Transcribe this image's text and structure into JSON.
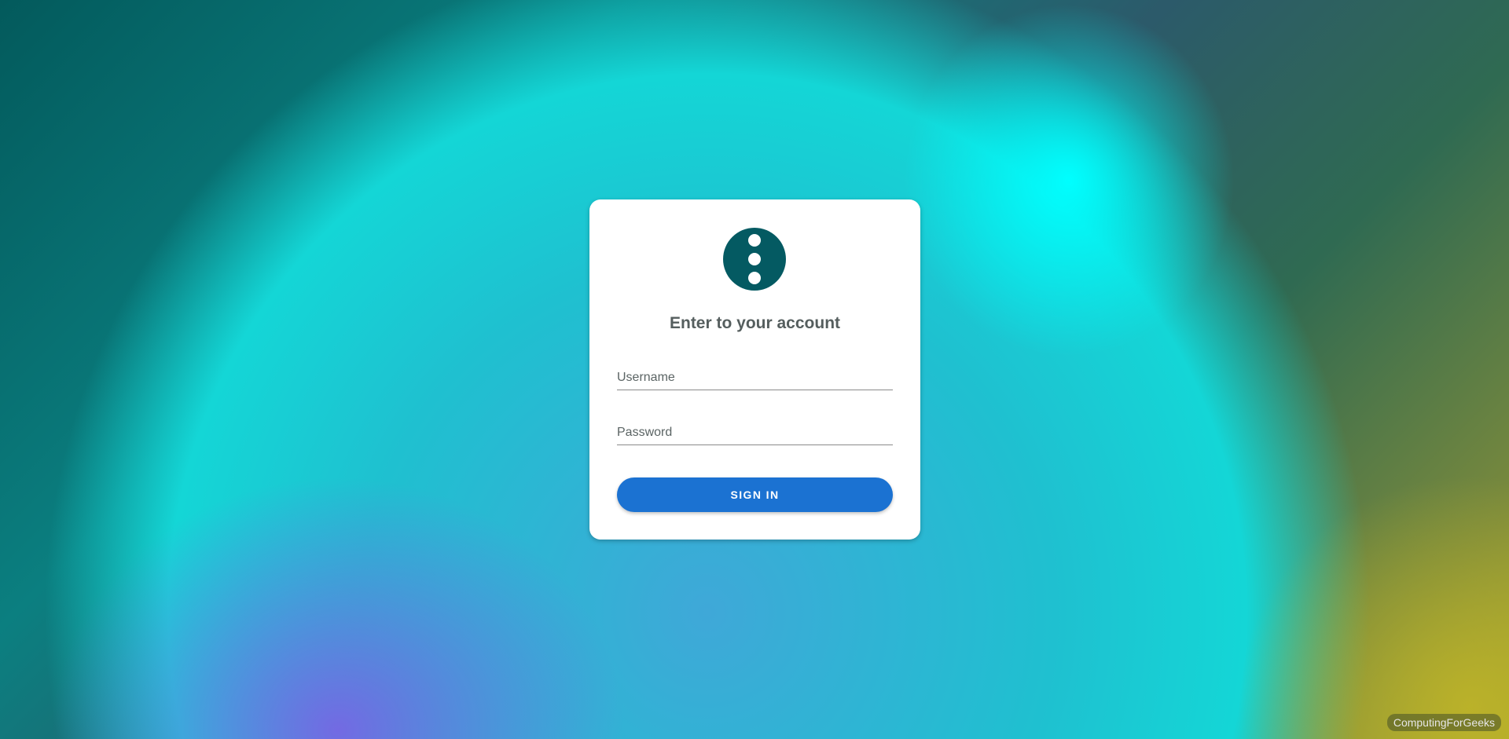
{
  "login": {
    "title": "Enter to your account",
    "username_placeholder": "Username",
    "password_placeholder": "Password",
    "signin_label": "SIGN IN"
  },
  "watermark": "ComputingForGeeks",
  "colors": {
    "logo": "#045a62",
    "button": "#1b72d2",
    "title_text": "#555e5e"
  },
  "icons": {
    "logo": "three-dots-vertical-icon"
  }
}
